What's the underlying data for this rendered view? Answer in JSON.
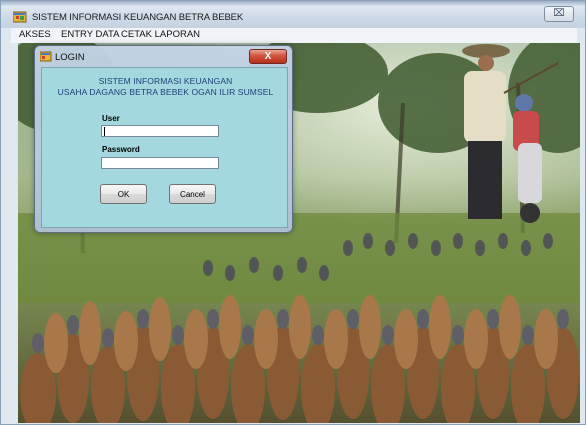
{
  "window": {
    "title": "SISTEM INFORMASI KEUANGAN BETRA BEBEK",
    "close_glyph": "⌧"
  },
  "menu": {
    "items": [
      {
        "label": "AKSES"
      },
      {
        "label": "ENTRY DATA"
      },
      {
        "label": "CETAK LAPORAN"
      }
    ]
  },
  "login": {
    "title": "LOGIN",
    "close_glyph": "X",
    "heading1": "SISTEM INFORMASI KEUANGAN",
    "heading2": "USAHA DAGANG BETRA BEBEK OGAN ILIR SUMSEL",
    "user_label": "User",
    "user_value": "",
    "password_label": "Password",
    "password_value": "",
    "ok_label": "OK",
    "cancel_label": "Cancel"
  },
  "colors": {
    "dialog_client": "#a3d9de",
    "heading": "#1e3f7a",
    "close_red": "#d2533d"
  },
  "icons": {
    "app": "app-window-icon",
    "login": "login-window-icon"
  }
}
